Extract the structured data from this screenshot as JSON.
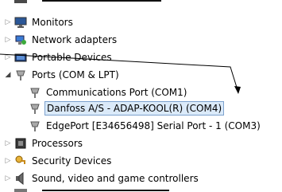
{
  "tree": {
    "items": [
      {
        "label": "Monitors",
        "icon": "monitor-icon",
        "expanded": false
      },
      {
        "label": "Network adapters",
        "icon": "network-adapter-icon",
        "expanded": false
      },
      {
        "label": "Portable Devices",
        "icon": "portable-devices-icon",
        "expanded": false
      },
      {
        "label": "Ports (COM & LPT)",
        "icon": "port-icon",
        "expanded": true
      },
      {
        "label": "Communications Port (COM1)",
        "icon": "port-icon"
      },
      {
        "label": "Danfoss A/S - ADAP-KOOL(R) (COM4)",
        "icon": "port-icon",
        "selected": true
      },
      {
        "label": "EdgePort [E34656498] Serial Port - 1 (COM3)",
        "icon": "port-icon"
      },
      {
        "label": "Processors",
        "icon": "processor-icon",
        "expanded": false
      },
      {
        "label": "Security Devices",
        "icon": "security-devices-icon",
        "expanded": false
      },
      {
        "label": "Sound, video and game controllers",
        "icon": "speaker-icon",
        "expanded": false
      }
    ]
  },
  "colors": {
    "selection_bg": "#dbeaf9",
    "selection_border": "#7da2ce",
    "arrow": "#000000"
  }
}
